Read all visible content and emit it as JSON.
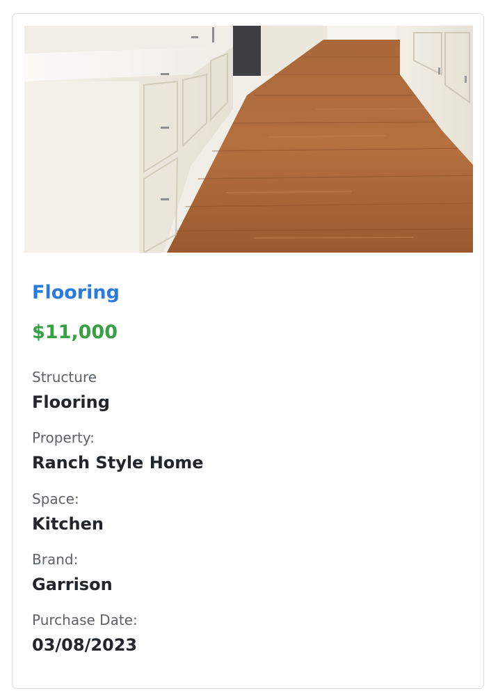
{
  "card": {
    "image_alt": "Kitchen with hardwood flooring",
    "title": "Flooring",
    "price": "$11,000",
    "details": [
      {
        "label": "Structure",
        "value": "Flooring"
      },
      {
        "label": "Property:",
        "value": "Ranch Style Home"
      },
      {
        "label": "Space:",
        "value": "Kitchen"
      },
      {
        "label": "Brand:",
        "value": "Garrison"
      },
      {
        "label": "Purchase Date:",
        "value": "03/08/2023"
      }
    ]
  },
  "colors": {
    "title": "#2a7be0",
    "price": "#37a042",
    "border": "#d7dde3"
  }
}
